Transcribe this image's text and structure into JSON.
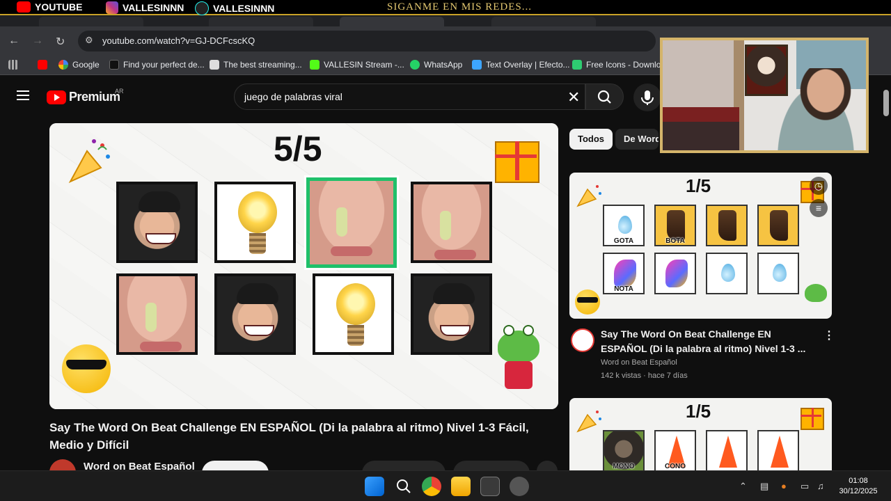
{
  "overlay": {
    "items": [
      {
        "label": "YOUTUBE",
        "icon": "youtube-icon",
        "color": "#ff0000"
      },
      {
        "label": "VALLESINNN",
        "icon": "instagram-icon",
        "color": "#c13584"
      },
      {
        "label": "VALLESINNN",
        "icon": "tiktok-icon",
        "color": "#ffffff"
      }
    ],
    "center_text": "SIGANME EN MIS REDES..."
  },
  "browser": {
    "url": "youtube.com/watch?v=GJ-DCFcscKQ",
    "bookmarks": [
      {
        "label": "",
        "icon": "apps-grid-icon"
      },
      {
        "label": "",
        "icon": "youtube-icon"
      },
      {
        "label": "Google",
        "icon": "google-icon"
      },
      {
        "label": "Find your perfect de...",
        "icon": "bookmark-k-icon"
      },
      {
        "label": "The best streaming...",
        "icon": "bookmark-icon"
      },
      {
        "label": "VALLESIN Stream -...",
        "icon": "kick-icon"
      },
      {
        "label": "WhatsApp",
        "icon": "whatsapp-icon"
      },
      {
        "label": "Text Overlay | Efecto...",
        "icon": "text-overlay-icon"
      },
      {
        "label": "Free Icons - Downlo",
        "icon": "check-icon"
      }
    ]
  },
  "youtube": {
    "brand": "Premium",
    "region": "AR",
    "search_query": "juego de palabras viral",
    "main_video": {
      "level_counter": "5/5",
      "title": "Say The Word On Beat Challenge EN ESPAÑOL (Di la palabra al ritmo) Nivel 1-3 Fácil, Medio y Difícil",
      "channel": "Word on Beat Español"
    },
    "chips": [
      "Todos",
      "De Word"
    ],
    "sidebar": {
      "video1": {
        "level_counter": "1/5",
        "tiles_row1": [
          "GOTA",
          "BOTA",
          "",
          ""
        ],
        "tiles_row2": [
          "NOTA",
          "",
          "",
          ""
        ],
        "title": "Say The Word On Beat Challenge EN ESPAÑOL (Di la palabra al ritmo) Nivel 1-3 ...",
        "channel": "Word on Beat Español",
        "stats": "142 k vistas · hace 7 días"
      },
      "video2": {
        "level_counter": "1/5",
        "tiles_row1": [
          "MONO",
          "CONO",
          "",
          ""
        ]
      }
    }
  },
  "taskbar": {
    "time": "01:08",
    "date": "30/12/2025"
  }
}
